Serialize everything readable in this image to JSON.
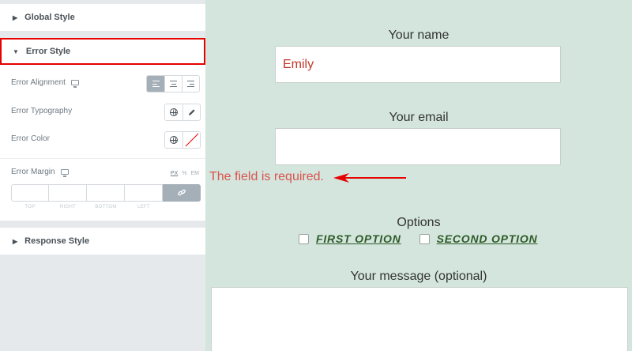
{
  "panel": {
    "global_style": "Global Style",
    "error_style": "Error Style",
    "response_style": "Response Style",
    "error_alignment": "Error Alignment",
    "error_typography": "Error Typography",
    "error_color": "Error Color",
    "error_margin": "Error Margin",
    "units": [
      "PX",
      "%",
      "EM"
    ],
    "dimension_labels": [
      "TOP",
      "RIGHT",
      "BOTTOM",
      "LEFT"
    ]
  },
  "form": {
    "name_label": "Your name",
    "name_value": "Emily",
    "email_label": "Your email",
    "error_message": "The field is required.",
    "options_label": "Options",
    "option1": "FIRST OPTION",
    "option2": "SECOND OPTION",
    "message_label": "Your message (optional)"
  },
  "colors": {
    "highlight": "#e60000",
    "error_text": "#d9534f",
    "option_text": "#2d5a27",
    "preview_bg": "#d3e5dc"
  }
}
